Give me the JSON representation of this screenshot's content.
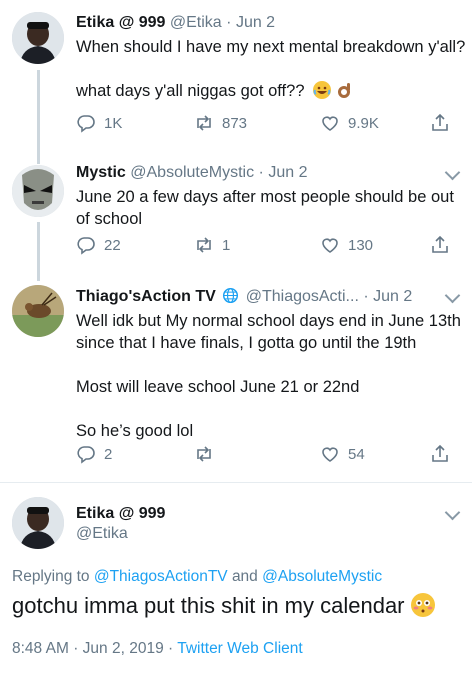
{
  "tweets": [
    {
      "name": "Etika @ 999",
      "handle": "@Etika",
      "dot": "·",
      "date": "Jun 2",
      "line1": "When should I have my next mental breakdown y'all?",
      "line2": "what days y'all niggas got off??",
      "reply_count": "1K",
      "retweet_count": "873",
      "like_count": "9.9K"
    },
    {
      "name": "Mystic",
      "handle": "@AbsoluteMystic",
      "dot": "·",
      "date": "Jun 2",
      "line1": "June 20 a few days after most people should be out",
      "line2": "of school",
      "reply_count": "22",
      "retweet_count": "1",
      "like_count": "130"
    },
    {
      "name": "Thiago'sAction TV",
      "handle": "@ThiagosActi...",
      "dot": "·",
      "date": "Jun 2",
      "line1": "Well idk but My normal school days end in June 13th",
      "line2": "since that I have finals, I gotta go until the 19th",
      "line3": "Most will leave school June 21 or 22nd",
      "line4": "So he’s good lol",
      "reply_count": "2",
      "retweet_count": "",
      "like_count": "54"
    }
  ],
  "focus_tweet": {
    "name": "Etika @ 999",
    "handle": "@Etika",
    "replying_prefix": "Replying to",
    "reply_to_1": "@ThiagosActionTV",
    "reply_and": "and",
    "reply_to_2": "@AbsoluteMystic",
    "text": "gotchu imma put this shit in my calendar",
    "time": "8:48 AM",
    "dot1": "·",
    "date": "Jun 2, 2019",
    "dot2": "·",
    "client": "Twitter Web Client"
  },
  "icons": [
    "reply-icon",
    "retweet-icon",
    "like-icon",
    "share-icon",
    "verified-globe-icon",
    "chevron-down-icon",
    "joy-emoji-icon",
    "ok-hand-emoji-icon",
    "flushed-emoji-icon"
  ],
  "colors": {
    "text": "#14171a",
    "muted": "#657786",
    "link": "#1da1f2",
    "line": "#ccd6dd",
    "divider": "#e6ecf0"
  }
}
